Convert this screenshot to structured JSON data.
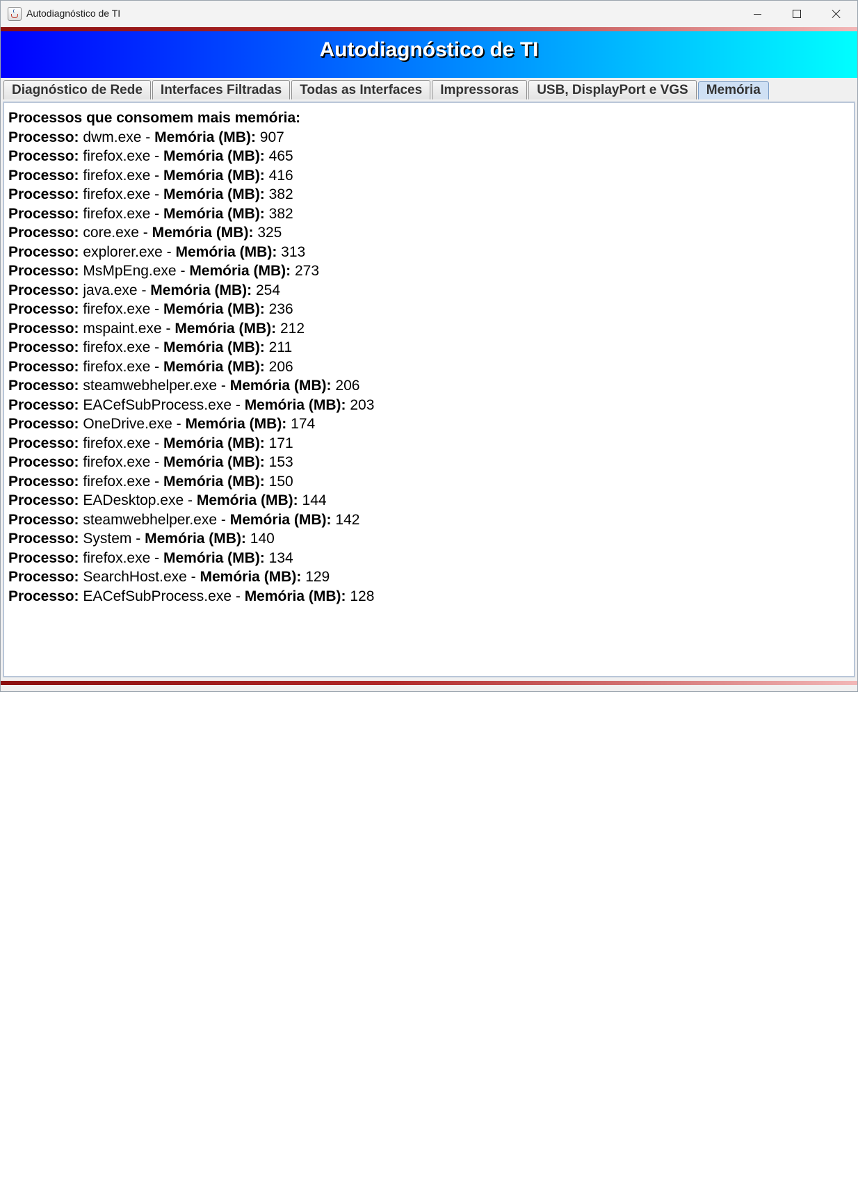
{
  "window": {
    "title": "Autodiagnóstico de TI"
  },
  "banner": {
    "title": "Autodiagnóstico de TI"
  },
  "colors": {
    "banner_start": "#0000ff",
    "banner_end": "#00ffff",
    "stripe": "#8b1010",
    "selected_tab": "#cfe0f4"
  },
  "tabs": [
    {
      "label": "Diagnóstico de Rede",
      "selected": false
    },
    {
      "label": "Interfaces Filtradas",
      "selected": false
    },
    {
      "label": "Todas as Interfaces",
      "selected": false
    },
    {
      "label": "Impressoras",
      "selected": false
    },
    {
      "label": "USB, DisplayPort e VGS",
      "selected": false
    },
    {
      "label": "Memória",
      "selected": true
    }
  ],
  "content": {
    "heading": "Processos que consomem mais memória:",
    "process_label": "Processo:",
    "memory_label": "Memória (MB):",
    "separator": "-",
    "processes": [
      {
        "name": "dwm.exe",
        "memory_mb": "907"
      },
      {
        "name": "firefox.exe",
        "memory_mb": "465"
      },
      {
        "name": "firefox.exe",
        "memory_mb": "416"
      },
      {
        "name": "firefox.exe",
        "memory_mb": "382"
      },
      {
        "name": "firefox.exe",
        "memory_mb": "382"
      },
      {
        "name": "core.exe",
        "memory_mb": "325"
      },
      {
        "name": "explorer.exe",
        "memory_mb": "313"
      },
      {
        "name": "MsMpEng.exe",
        "memory_mb": "273"
      },
      {
        "name": "java.exe",
        "memory_mb": "254"
      },
      {
        "name": "firefox.exe",
        "memory_mb": "236"
      },
      {
        "name": "mspaint.exe",
        "memory_mb": "212"
      },
      {
        "name": "firefox.exe",
        "memory_mb": "211"
      },
      {
        "name": "firefox.exe",
        "memory_mb": "206"
      },
      {
        "name": "steamwebhelper.exe",
        "memory_mb": "206"
      },
      {
        "name": "EACefSubProcess.exe",
        "memory_mb": "203"
      },
      {
        "name": "OneDrive.exe",
        "memory_mb": "174"
      },
      {
        "name": "firefox.exe",
        "memory_mb": "171"
      },
      {
        "name": "firefox.exe",
        "memory_mb": "153"
      },
      {
        "name": "firefox.exe",
        "memory_mb": "150"
      },
      {
        "name": "EADesktop.exe",
        "memory_mb": "144"
      },
      {
        "name": "steamwebhelper.exe",
        "memory_mb": "142"
      },
      {
        "name": "System",
        "memory_mb": "140"
      },
      {
        "name": "firefox.exe",
        "memory_mb": "134"
      },
      {
        "name": "SearchHost.exe",
        "memory_mb": "129"
      },
      {
        "name": "EACefSubProcess.exe",
        "memory_mb": "128"
      }
    ]
  }
}
